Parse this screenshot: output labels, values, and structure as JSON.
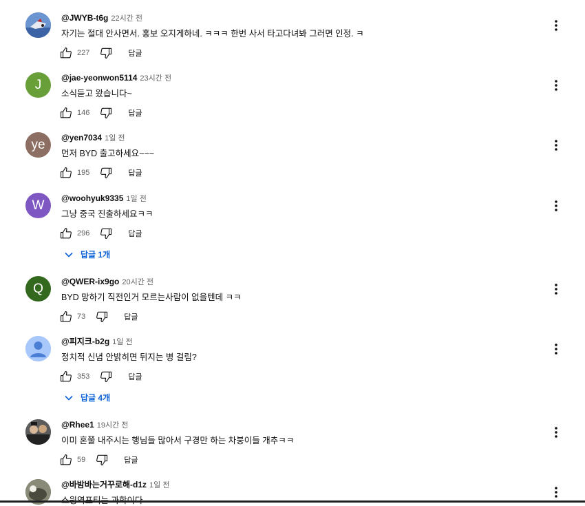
{
  "comments": [
    {
      "author": "@JWYB-t6g",
      "time": "22시간 전",
      "text": "자기는 절대 안사면서. 홍보 오지게하네. ㅋㅋㅋ 한번 사서 타고다녀봐 그러면 인정. ㅋ",
      "likes": "227",
      "reply_label": "답글",
      "avatar_letter": "",
      "avatar_color": "#3f6fb3"
    },
    {
      "author": "@jae-yeonwon5114",
      "time": "23시간 전",
      "text": "소식듣고 왔습니다~",
      "likes": "146",
      "reply_label": "답글",
      "avatar_letter": "J",
      "avatar_color": "#689f38"
    },
    {
      "author": "@yen7034",
      "time": "1일 전",
      "text": "먼저 BYD 출고하세요~~~",
      "likes": "195",
      "reply_label": "답글",
      "avatar_letter": "ye",
      "avatar_color": "#8d6e63"
    },
    {
      "author": "@woohyuk9335",
      "time": "1일 전",
      "text": "그냥 중국 진출하세요ㅋㅋ",
      "likes": "296",
      "reply_label": "답글",
      "avatar_letter": "W",
      "avatar_color": "#7e57c2",
      "replies_label": "답글 1개"
    },
    {
      "author": "@QWER-ix9go",
      "time": "20시간 전",
      "text": "BYD 망하기 직전인거 모르는사람이 없을텐데 ㅋㅋ",
      "likes": "73",
      "reply_label": "답글",
      "avatar_letter": "Q",
      "avatar_color": "#33691e"
    },
    {
      "author": "@피지크-b2g",
      "time": "1일 전",
      "text": "정치적 신념 안밝히면 뒤지는 병 걸림?",
      "likes": "353",
      "reply_label": "답글",
      "avatar_letter": "",
      "avatar_color": "#a8c7fa",
      "replies_label": "답글 4개"
    },
    {
      "author": "@Rhee1",
      "time": "19시간 전",
      "text": "이미 혼쭐 내주시는 행님들 많아서 구경만 하는 차붕이들 개추ㅋㅋ",
      "likes": "59",
      "reply_label": "답글",
      "avatar_letter": "",
      "avatar_color": "#3a3a3a"
    },
    {
      "author": "@바밤바는거꾸로해-d1z",
      "time": "1일 전",
      "text": "스윙역포티는 과학이다",
      "likes": "",
      "reply_label": "",
      "avatar_letter": "",
      "avatar_color": "#6b6b5a"
    }
  ]
}
